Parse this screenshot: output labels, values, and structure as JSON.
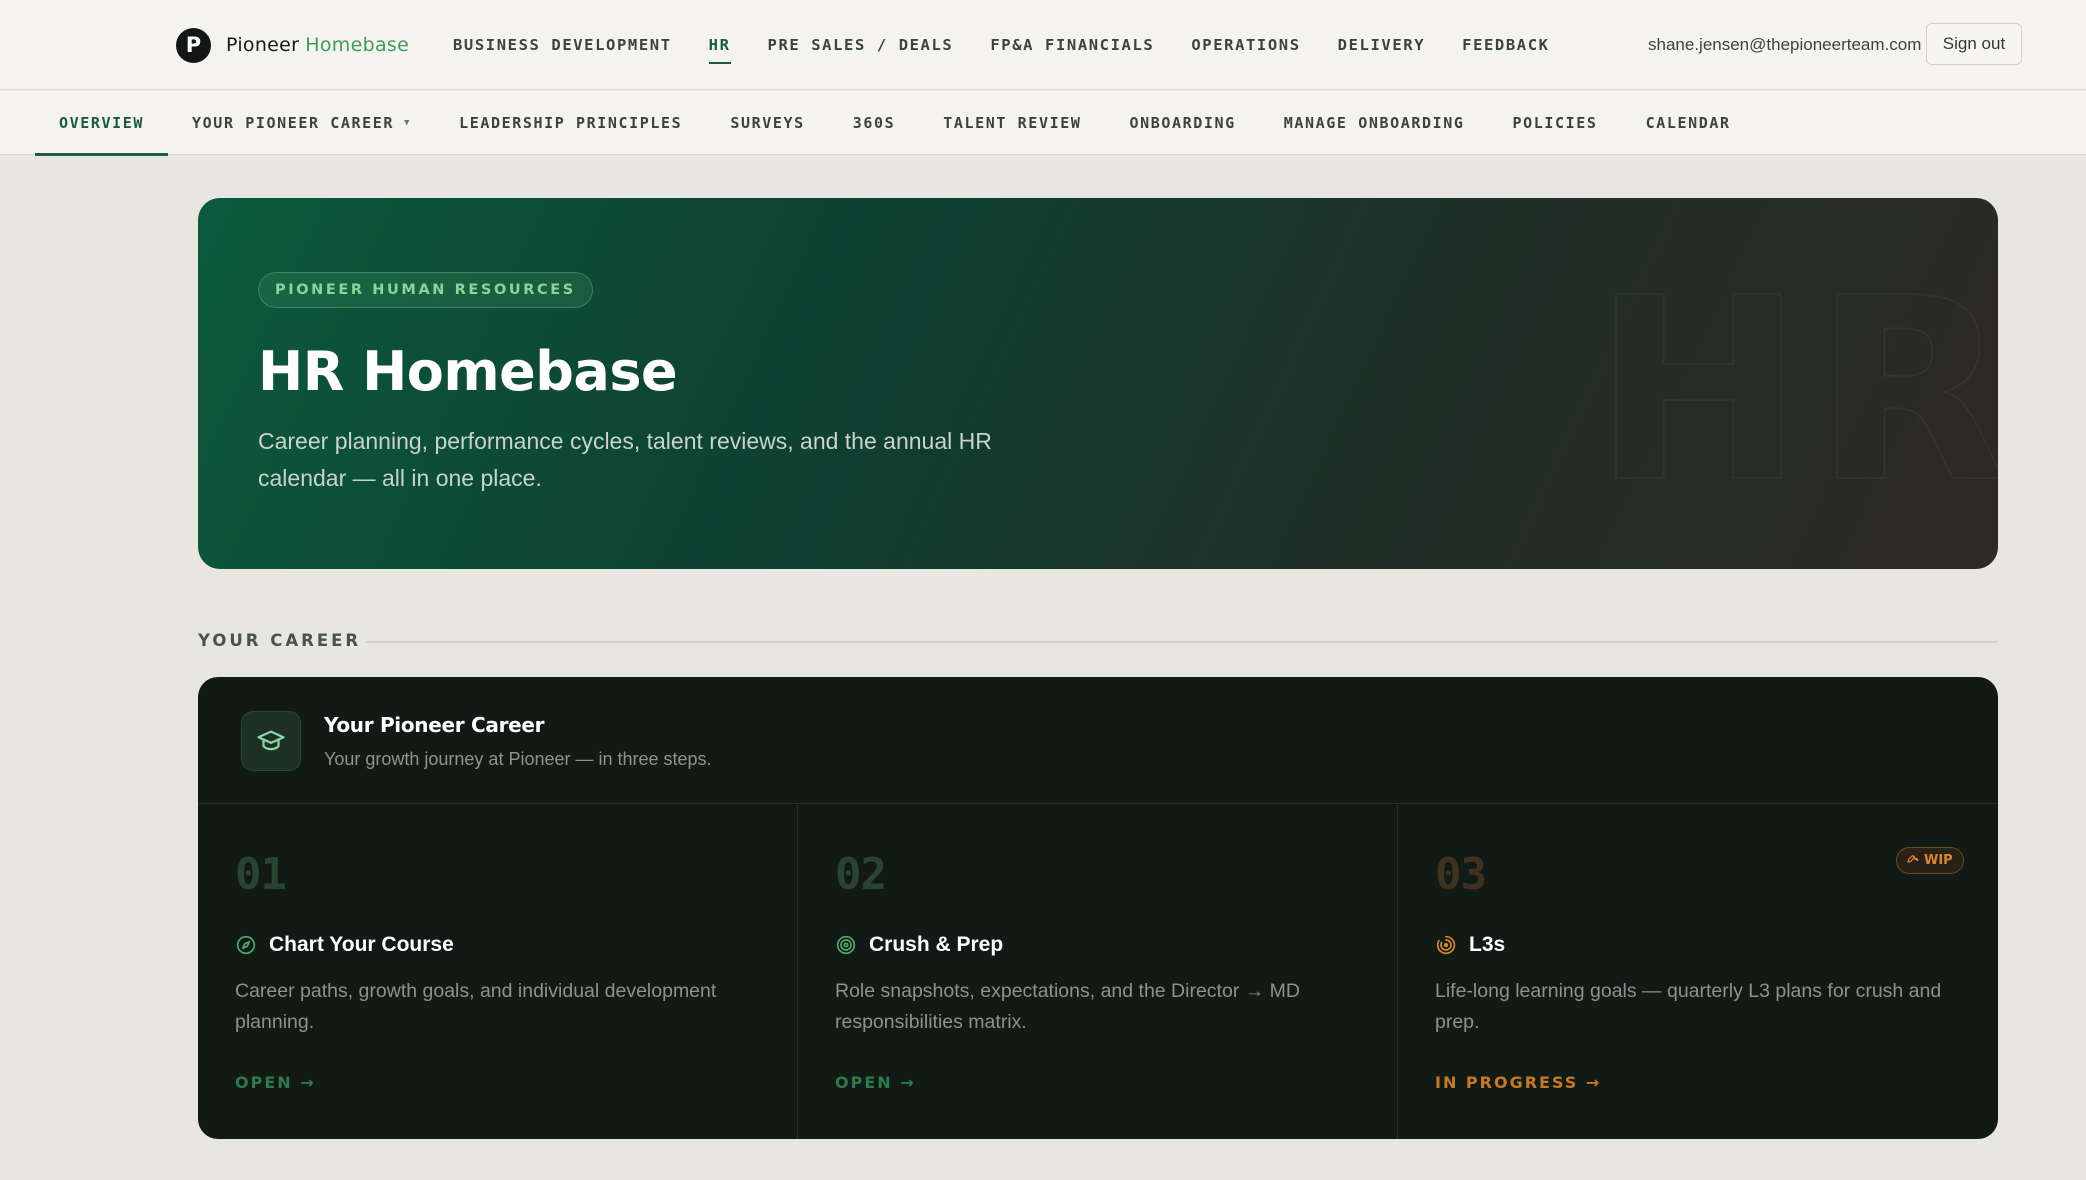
{
  "brand": {
    "logo_letter": "P",
    "name": "Pioneer",
    "accent": "Homebase"
  },
  "main_nav": [
    {
      "label": "BUSINESS DEVELOPMENT",
      "active": false
    },
    {
      "label": "HR",
      "active": true
    },
    {
      "label": "PRE SALES / DEALS",
      "active": false
    },
    {
      "label": "FP&A FINANCIALS",
      "active": false
    },
    {
      "label": "OPERATIONS",
      "active": false
    },
    {
      "label": "DELIVERY",
      "active": false
    },
    {
      "label": "FEEDBACK",
      "active": false
    }
  ],
  "user": {
    "email": "shane.jensen@thepioneerteam.com",
    "signout_label": "Sign out"
  },
  "sub_nav": [
    {
      "label": "OVERVIEW",
      "active": true
    },
    {
      "label": "YOUR PIONEER CAREER",
      "has_caret": true,
      "caret_icon": "caret-down-icon"
    },
    {
      "label": "LEADERSHIP PRINCIPLES"
    },
    {
      "label": "SURVEYS"
    },
    {
      "label": "360S"
    },
    {
      "label": "TALENT REVIEW"
    },
    {
      "label": "ONBOARDING"
    },
    {
      "label": "MANAGE ONBOARDING"
    },
    {
      "label": "POLICIES"
    },
    {
      "label": "CALENDAR"
    }
  ],
  "hero": {
    "pill": "PIONEER HUMAN RESOURCES",
    "title": "HR Homebase",
    "subtitle_line1": "Career planning, performance cycles, talent reviews, and the annual HR",
    "subtitle_line2": "calendar — all in one place.",
    "watermark": "HR"
  },
  "section": {
    "label": "YOUR CAREER"
  },
  "career": {
    "icon": "graduation-cap-icon",
    "title": "Your Pioneer Career",
    "subtitle": "Your growth journey at Pioneer — in three steps.",
    "steps": [
      {
        "num": "01",
        "icon": "compass-icon",
        "title": "Chart Your Course",
        "desc": "Career paths, growth goals, and individual development planning.",
        "link": "OPEN →"
      },
      {
        "num": "02",
        "icon": "target-icon",
        "title": "Crush & Prep",
        "desc": "Role snapshots, expectations, and the Director → MD responsibilities matrix.",
        "link": "OPEN →"
      },
      {
        "num": "03",
        "icon": "progress-icon",
        "title": "L3s",
        "desc": "Life-long learning goals — quarterly L3 plans for crush and prep.",
        "link": "IN PROGRESS →",
        "badge": "WIP",
        "badge_icon": "wrench-icon"
      }
    ]
  },
  "colors": {
    "accent_green": "#1d5a3e",
    "brand_green": "#3f9a5c",
    "wip_orange": "#c77a22",
    "card_dark": "#121a16"
  }
}
